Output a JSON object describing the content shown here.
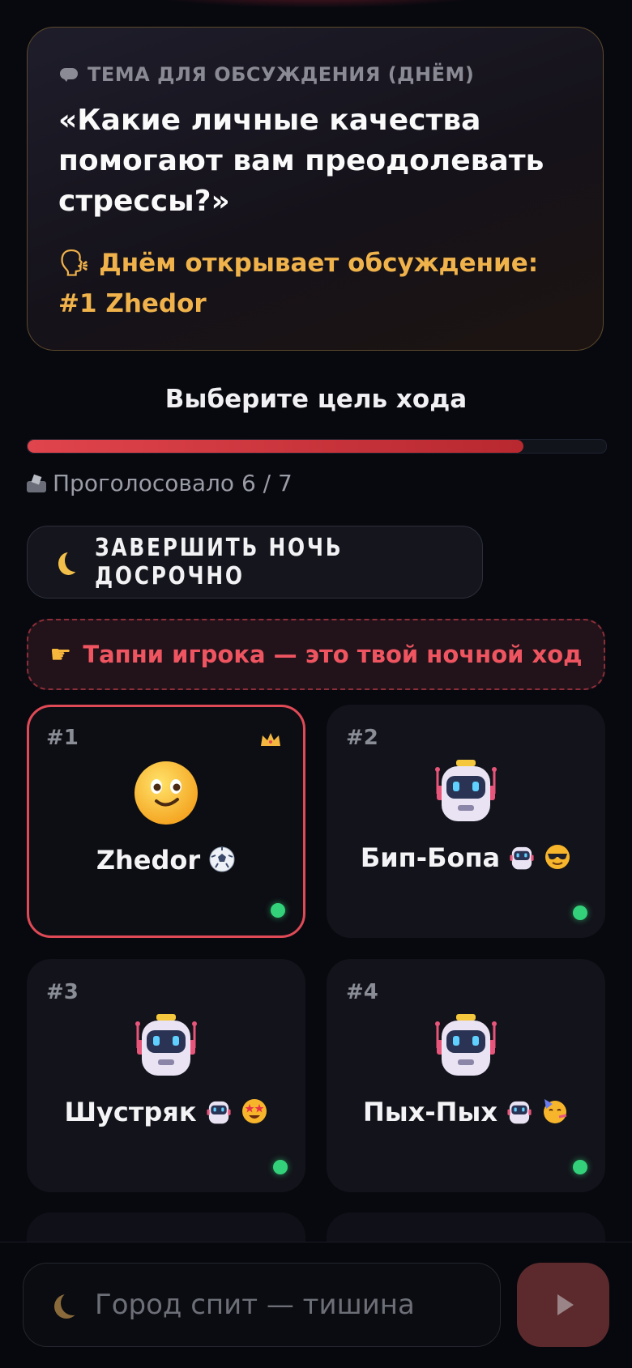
{
  "topic": {
    "label": "ТЕМА ДЛЯ ОБСУЖДЕНИЯ (ДНЁМ)",
    "question": "«Какие личные качества помогают вам преодолевать стрессы?»",
    "opener": "🗣 Днём открывает обсуждение: #1 Zhedor"
  },
  "voting": {
    "title": "Выберите цель хода",
    "progress": 0.857,
    "votes_text": "Проголосовало 6 / 7"
  },
  "end_night_button": {
    "label": "ЗАВЕРШИТЬ НОЧЬ ДОСРОЧНО",
    "icon": "moon-icon"
  },
  "hint": {
    "icon": "pointing-hand-icon",
    "text": "Тапни игрока — это твой ночной ход"
  },
  "players": [
    {
      "number": "#1",
      "name": "Zhedor",
      "avatar": "smiling-face-icon",
      "tag": "soccer-ball-icon",
      "host": true,
      "selected": true,
      "online": true
    },
    {
      "number": "#2",
      "name": "Бип-Бопа",
      "avatar": "robot-icon",
      "tags": [
        "robot-icon",
        "sunglasses-face-icon"
      ],
      "online": true
    },
    {
      "number": "#3",
      "name": "Шустряк",
      "avatar": "robot-icon",
      "tags": [
        "robot-icon",
        "star-struck-face-icon"
      ],
      "online": true
    },
    {
      "number": "#4",
      "name": "Пых-Пых",
      "avatar": "robot-icon",
      "tags": [
        "robot-icon",
        "partying-face-icon"
      ],
      "online": true
    }
  ],
  "chat": {
    "placeholder": "Город спит — тишина",
    "send_icon": "play-icon"
  },
  "colors": {
    "accent_red": "#e04a56",
    "gold": "#f0b24a",
    "online": "#33d17a",
    "background": "#08090f"
  }
}
